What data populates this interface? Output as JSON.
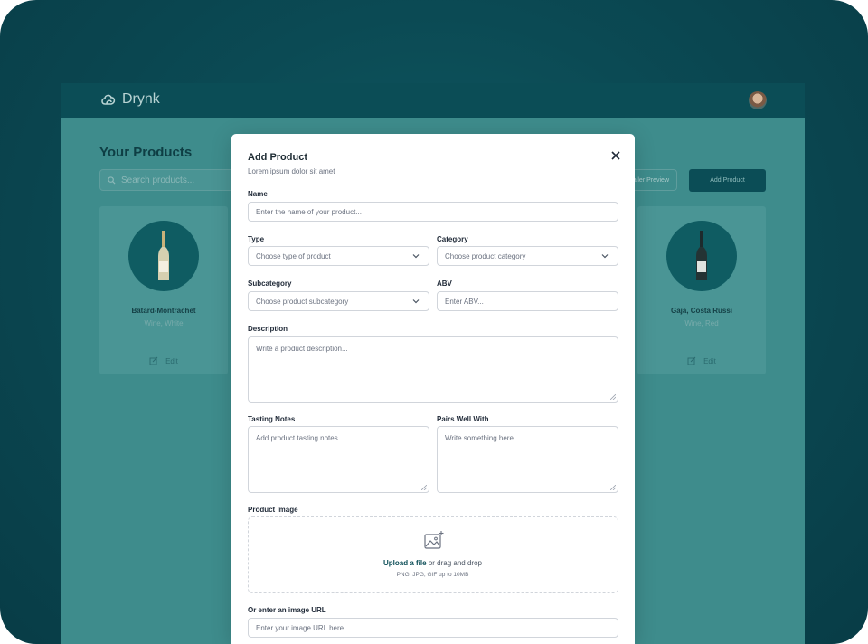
{
  "app": {
    "brand": "Drynk",
    "page_title": "Your Products",
    "search_placeholder": "Search products...",
    "retailer_preview_label": "tailer Preview",
    "add_product_label": "Add Product",
    "edit_label": "Edit",
    "products": [
      {
        "name": "Bâtard-Montrachet",
        "subtitle": "Wine, White"
      },
      {
        "name": "Gaja, Costa Russi",
        "subtitle": "Wine, Red"
      }
    ]
  },
  "modal": {
    "title": "Add Product",
    "subtitle": "Lorem ipsum dolor sit amet",
    "name_label": "Name",
    "name_placeholder": "Enter the name of your product...",
    "type_label": "Type",
    "type_placeholder": "Choose type of product",
    "category_label": "Category",
    "category_placeholder": "Choose product category",
    "subcategory_label": "Subcategory",
    "subcategory_placeholder": "Choose product subcategory",
    "abv_label": "ABV",
    "abv_placeholder": "Enter ABV...",
    "description_label": "Description",
    "description_placeholder": "Write a product description...",
    "tasting_label": "Tasting Notes",
    "tasting_placeholder": "Add product tasting notes...",
    "pairs_label": "Pairs Well With",
    "pairs_placeholder": "Write something here...",
    "image_label": "Product Image",
    "upload_link": "Upload a file",
    "upload_rest": "or drag and drop",
    "upload_hint": "PNG, JPG, GIF up to 10MB",
    "url_label": "Or enter an image URL",
    "url_placeholder": "Enter your image URL here..."
  },
  "colors": {
    "brand_dark": "#0b4d56",
    "overlay": "#3e8c8c"
  },
  "icons": [
    "cloud-logo-icon",
    "search-icon",
    "edit-icon",
    "close-icon",
    "chevron-down-icon",
    "image-add-icon",
    "resize-grip-icon"
  ]
}
